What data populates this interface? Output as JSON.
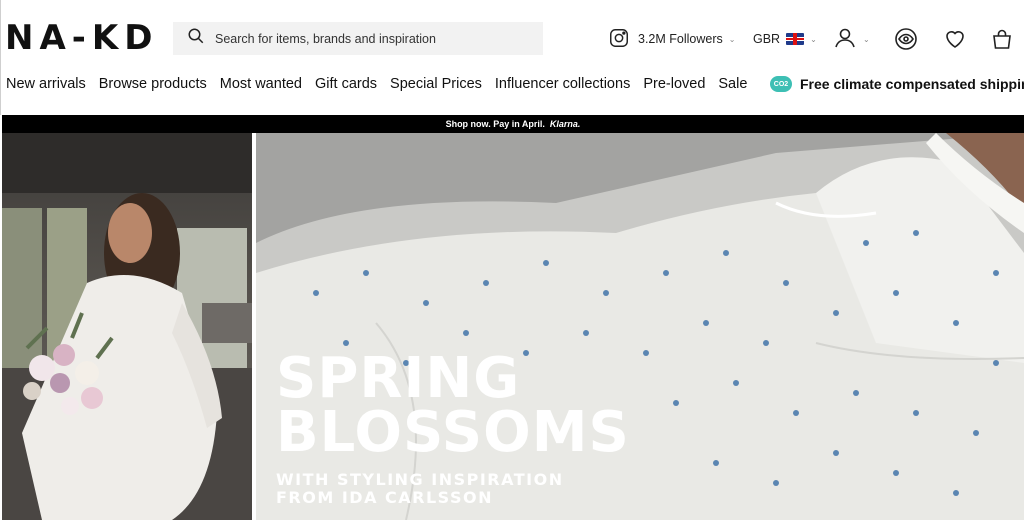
{
  "brand": {
    "logo": "NA-KD"
  },
  "search": {
    "placeholder": "Search for items, brands and inspiration",
    "icon": "search-icon"
  },
  "header": {
    "followers": "3.2M Followers",
    "country": "GBR",
    "icons": [
      "instagram-icon",
      "uk-flag-icon",
      "account-icon",
      "eye-icon",
      "heart-icon",
      "bag-icon"
    ]
  },
  "nav": {
    "items": [
      {
        "label": "New arrivals"
      },
      {
        "label": "Browse products"
      },
      {
        "label": "Most wanted"
      },
      {
        "label": "Gift cards"
      },
      {
        "label": "Special Prices"
      },
      {
        "label": "Influencer collections"
      },
      {
        "label": "Pre-loved"
      },
      {
        "label": "Sale"
      }
    ],
    "climate_badge": "CO2",
    "climate_text": "Free climate compensated shipping"
  },
  "promo": {
    "text": "Shop now. Pay in April.",
    "brand": "Klarna."
  },
  "hero": {
    "title_line1": "SPRING",
    "title_line2": "BLOSSOMS",
    "subtitle_line1": "WITH STYLING INSPIRATION",
    "subtitle_line2": "FROM IDA CARLSSON"
  },
  "colors": {
    "accent": "#3dbfb4",
    "promo_bg": "#000000",
    "search_bg": "#f2f2f2"
  }
}
